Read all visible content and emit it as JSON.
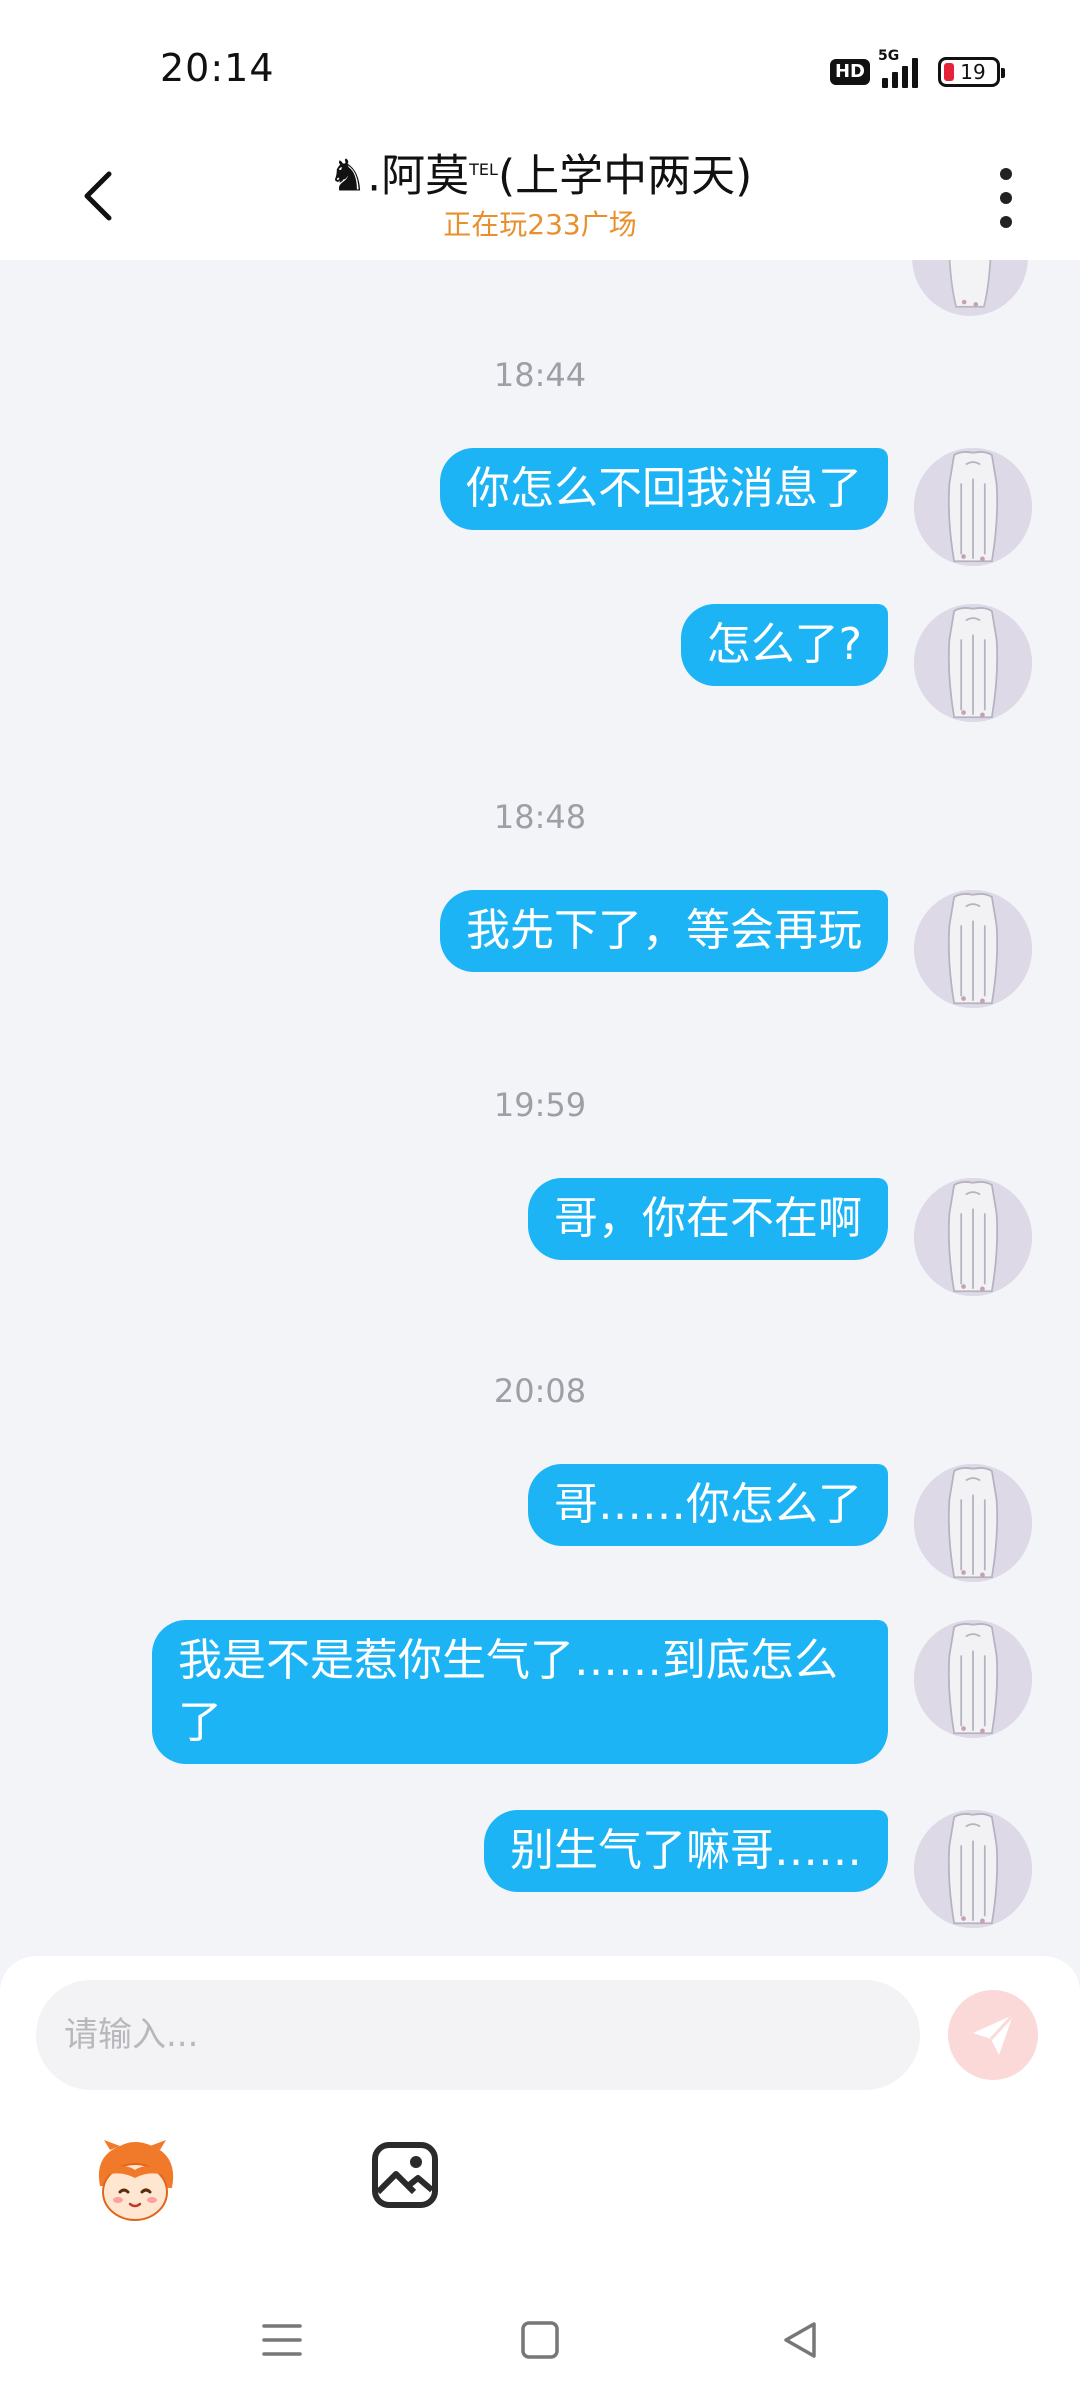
{
  "status_bar": {
    "time": "20:14",
    "hd_badge": "HD",
    "network": "5G",
    "battery": "19",
    "battery_color": "#e5233a"
  },
  "header": {
    "title_icon": "chess-knight-icon",
    "title_prefix": "♞.阿莫",
    "title_sup": "TEL",
    "title_suffix": "(上学中两天)",
    "subtitle": "正在玩233广场",
    "subtitle_color": "#e8902e"
  },
  "messages": [
    {
      "time": "18:44"
    },
    {
      "text": "你怎么不回我消息了"
    },
    {
      "text": "怎么了?"
    },
    {
      "time": "18:48"
    },
    {
      "text": "我先下了，等会再玩"
    },
    {
      "time": "19:59"
    },
    {
      "text": "哥，你在不在啊"
    },
    {
      "time": "20:08"
    },
    {
      "text": "哥……你怎么了"
    },
    {
      "text": "我是不是惹你生气了……到底怎么了"
    },
    {
      "text": "别生气了嘛哥……"
    }
  ],
  "colors": {
    "bubble": "#1db4f5",
    "background": "#f2f4f8"
  },
  "input": {
    "placeholder": "请输入..."
  },
  "toolbar": {
    "icons": [
      "mascot-emoji-icon",
      "image-icon"
    ]
  },
  "nav": {
    "icons": [
      "menu-icon",
      "home-icon",
      "back-triangle-icon"
    ]
  }
}
